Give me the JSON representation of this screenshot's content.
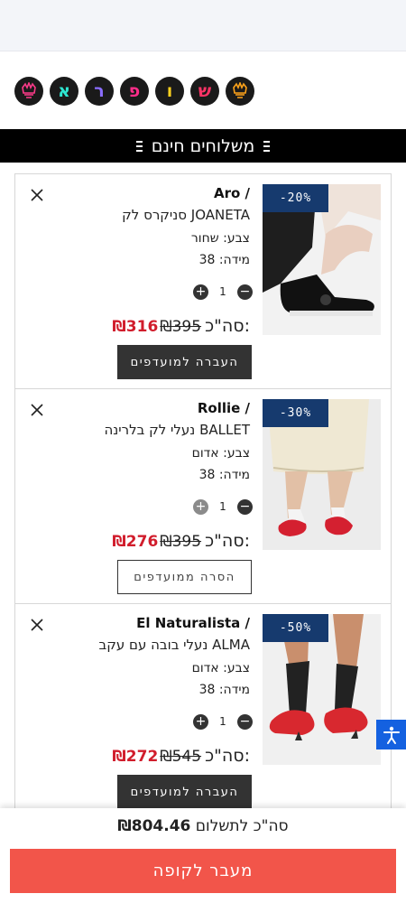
{
  "logo": {
    "letters": [
      "ש",
      "ו",
      "פ",
      "ר",
      "א"
    ],
    "colors": [
      "#ff3366",
      "#ffd21f",
      "#ff2d8a",
      "#8a6dff",
      "#2ee6d1"
    ]
  },
  "banner": {
    "text": "משלוחים חינם"
  },
  "items": [
    {
      "discount": "-20%",
      "brand": "Aro /",
      "name": "סניקרס לק JOANETA",
      "color": "צבע: שחור",
      "size": "מידה: 38",
      "qty": "1",
      "new_price": "₪316",
      "old_price": "₪395",
      "total_label": "סה\"כ:",
      "action": "העברה למועדפים"
    },
    {
      "discount": "-30%",
      "brand": "Rollie /",
      "name": "נעלי לק בלרינה BALLET",
      "color": "צבע: אדום",
      "size": "מידה: 38",
      "qty": "1",
      "new_price": "₪276",
      "old_price": "₪395",
      "total_label": "סה\"כ:",
      "action": "הסרה ממועדפים"
    },
    {
      "discount": "-50%",
      "brand": "El Naturalista /",
      "name": "נעלי בובה עם עקב ALMA",
      "color": "צבע: אדום",
      "size": "מידה: 38",
      "qty": "1",
      "new_price": "₪272",
      "old_price": "₪545",
      "total_label": "סה\"כ:",
      "action": "העברה למועדפים"
    }
  ],
  "footer": {
    "sum_label": "סה\"כ לתשלום",
    "sum_value": "₪804.46",
    "checkout": "מעבר לקופה"
  },
  "colors": {
    "accent": "#f2554a",
    "sale": "#d11d2c",
    "badge": "#163a6e",
    "a11y": "#1461e0"
  }
}
